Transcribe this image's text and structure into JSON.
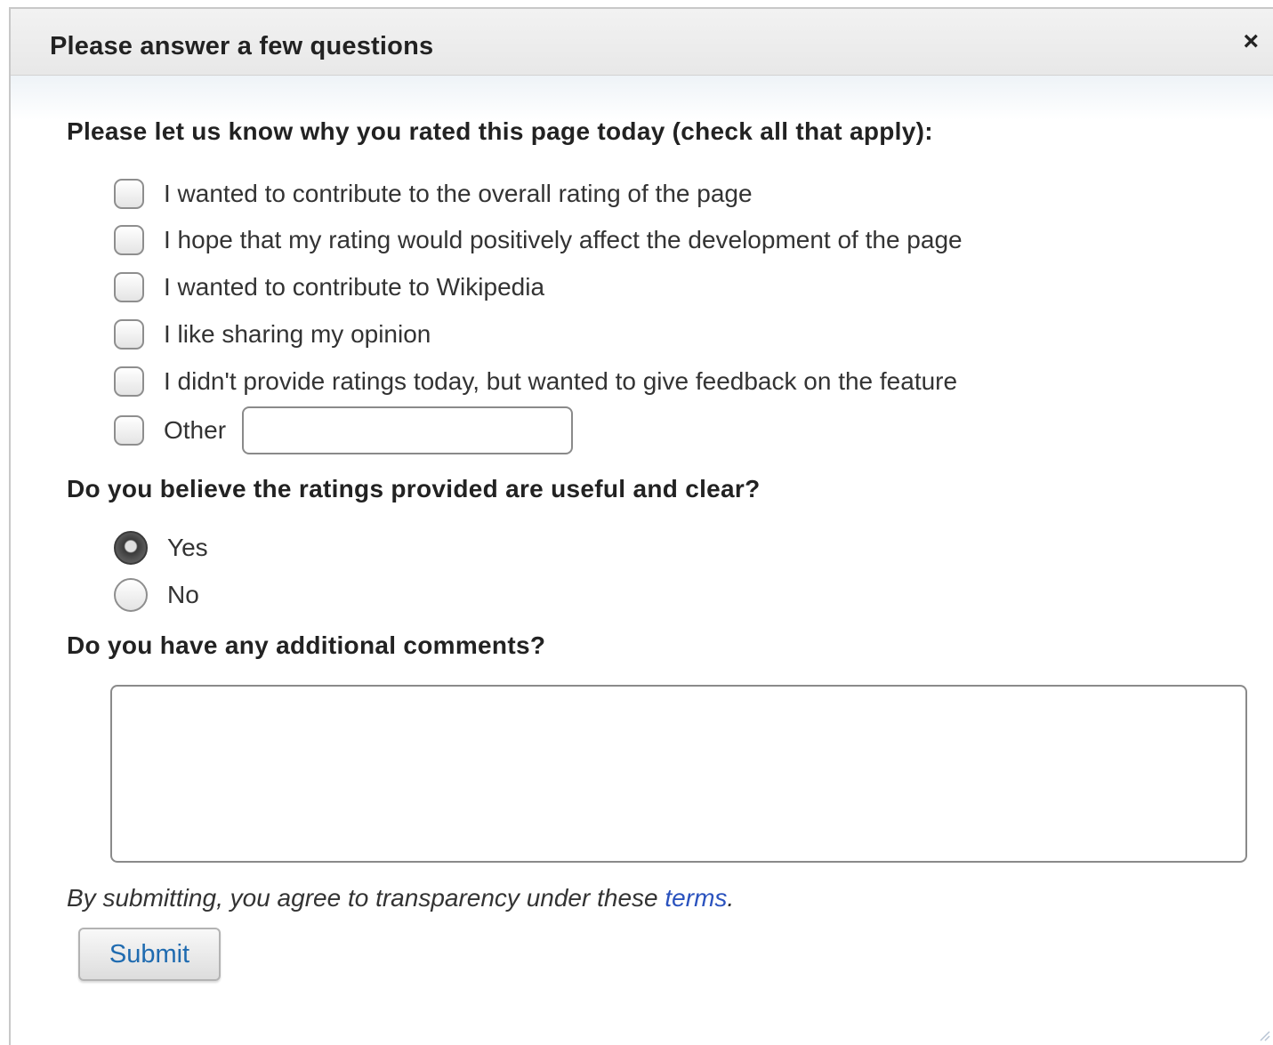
{
  "dialog": {
    "title": "Please answer a few questions",
    "close_glyph": "×"
  },
  "q1": {
    "label": "Please let us know why you rated this page today (check all that apply):",
    "options": [
      "I wanted to contribute to the overall rating of the page",
      "I hope that my rating would positively affect the development of the page",
      "I wanted to contribute to Wikipedia",
      "I like sharing my opinion",
      "I didn't provide ratings today, but wanted to give feedback on the feature",
      "Other"
    ],
    "other_value": ""
  },
  "q2": {
    "label": "Do you believe the ratings provided are useful and clear?",
    "options": [
      "Yes",
      "No"
    ],
    "selected": "Yes"
  },
  "q3": {
    "label": "Do you have any additional comments?",
    "value": ""
  },
  "footer": {
    "terms_prefix": "By submitting, you agree to transparency under these ",
    "terms_link": "terms",
    "terms_suffix": ".",
    "submit_label": "Submit"
  },
  "colors": {
    "link": "#2a52be",
    "submit_text": "#1f6bb0"
  },
  "icons": {
    "close": "close-icon",
    "resize": "resize-handle-icon"
  }
}
